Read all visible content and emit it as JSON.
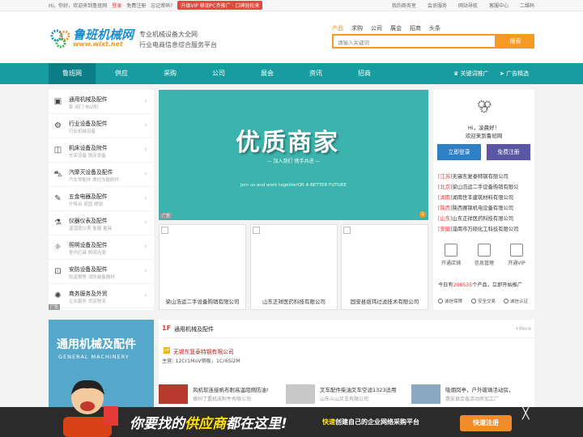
{
  "topbar": {
    "greeting": "Hi，你好，欢迎来到鲁班网",
    "login": "登录",
    "register": "免费注册",
    "forgot": "忘记密码?",
    "promo": "升级VIP 移动PC齐推广 · 口碑轻松来",
    "links": [
      "我的商务室",
      "会员服务",
      "网站导航",
      "客服中心",
      "二维码"
    ]
  },
  "header": {
    "logo_title": "鲁班机械网",
    "logo_url": "www.wixt.net",
    "slogan_1": "专业机械设备大全网",
    "slogan_2": "行业电商信息综合服务平台",
    "search_tabs": [
      "产品",
      "求购",
      "公司",
      "展会",
      "招商",
      "头条"
    ],
    "search_placeholder": "请输入关键词",
    "search_button": "搜索"
  },
  "nav": {
    "items": [
      "鲁班网",
      "供应",
      "采购",
      "公司",
      "展会",
      "资讯",
      "招商"
    ],
    "keyword_promo": "关键词推广",
    "ad_select": "广告精选"
  },
  "categories": [
    {
      "title": "通用机械及配件",
      "sub": "泵   阀门   电动机",
      "icon": "box-icon"
    },
    {
      "title": "行业设备及配件",
      "sub": "行业机械设备",
      "icon": "gear-icon"
    },
    {
      "title": "机床设备及附件",
      "sub": "车床设备   铣床设备",
      "icon": "lathe-icon"
    },
    {
      "title": "汽摩灭设备及配件",
      "sub": "汽车零配件   摩托车配附件",
      "icon": "car-icon"
    },
    {
      "title": "五金电器及配件",
      "sub": "升降台   紧固   焊钳",
      "icon": "wrench-icon"
    },
    {
      "title": "仪器仪表及配件",
      "sub": "温湿度仪表   衡器   量具",
      "icon": "flask-icon"
    },
    {
      "title": "照明设备及配件",
      "sub": "室内灯具   照明光源",
      "icon": "bulb-icon"
    },
    {
      "title": "安防设备及配件",
      "sub": "防盗报警   消防装备器材",
      "icon": "lock-icon"
    },
    {
      "title": "商务服务及外贸",
      "sub": "企业服务   货运物流",
      "icon": "sun-icon"
    }
  ],
  "ad_label": "广告",
  "banner": {
    "title": "优质商家",
    "subtitle": "— 加入我们 携手共进 —",
    "english": "Join us and work togetherOR A BETTER FUTURE",
    "page": "1"
  },
  "cards": [
    "梁山浩运二手设备购销有限公司",
    "山东正祥医药科技有限公司",
    "固安县煜玮过滤技术有限公司"
  ],
  "panel": {
    "hello": "Hi，凌晨好！",
    "welcome": "欢迎来到鲁班网",
    "login_button": "立即登录",
    "register_button": "免费注册",
    "news": [
      {
        "region": "[江苏]",
        "name": "无锡东复泰特钢有限公司"
      },
      {
        "region": "[北京]",
        "name": "梁山浩运二手设备购销有限公"
      },
      {
        "region": "[湖南]",
        "name": "湖南世丰建筑材料有限公司"
      },
      {
        "region": "[陕西]",
        "name": "陕西赛锦机电设备有限公司"
      },
      {
        "region": "[山东]",
        "name": "山东正祥医药科技有限公司"
      },
      {
        "region": "[安徽]",
        "name": "淄南市万硕化工科技有限公司"
      }
    ],
    "services": [
      "开通店铺",
      "信息管理",
      "开通VIP"
    ],
    "count_prefix": "今日有",
    "count_value": "208535",
    "count_suffix": "个产品，立即开始推广",
    "guarantees": [
      "诚信保障",
      "安全交易",
      "诚信认证"
    ]
  },
  "floor": {
    "number": "1F",
    "title": "通用机械及配件",
    "more": "+More",
    "image_title": "通用机械及配件",
    "image_sub": "GENERAL MACHINERY",
    "vip": "VIP",
    "company": "无锡东复泰特钢有限公司",
    "main": "主营: 12Cr1MoV钢板，1Cr6Si2M",
    "items": [
      {
        "name": "风机软连接帆布耐高温阻燃防油!",
        "company": "德州丁置机床附件有限公司"
      },
      {
        "name": "叉车配件柴油叉车空滤1323适用",
        "company": "山东斗山叉车有限公司"
      },
      {
        "name": "吸烟岗亭，户外玻璃活动房，",
        "company": "惠安县合鑫活动房加工厂"
      }
    ]
  },
  "bottom_ad": {
    "slogan_a": "你要找的",
    "slogan_b": "供应商",
    "slogan_c": "都在这里!",
    "sub_a": "快速",
    "sub_b": "创建自己的企业网络采购平台",
    "register": "快速注册",
    "close": "╳"
  }
}
